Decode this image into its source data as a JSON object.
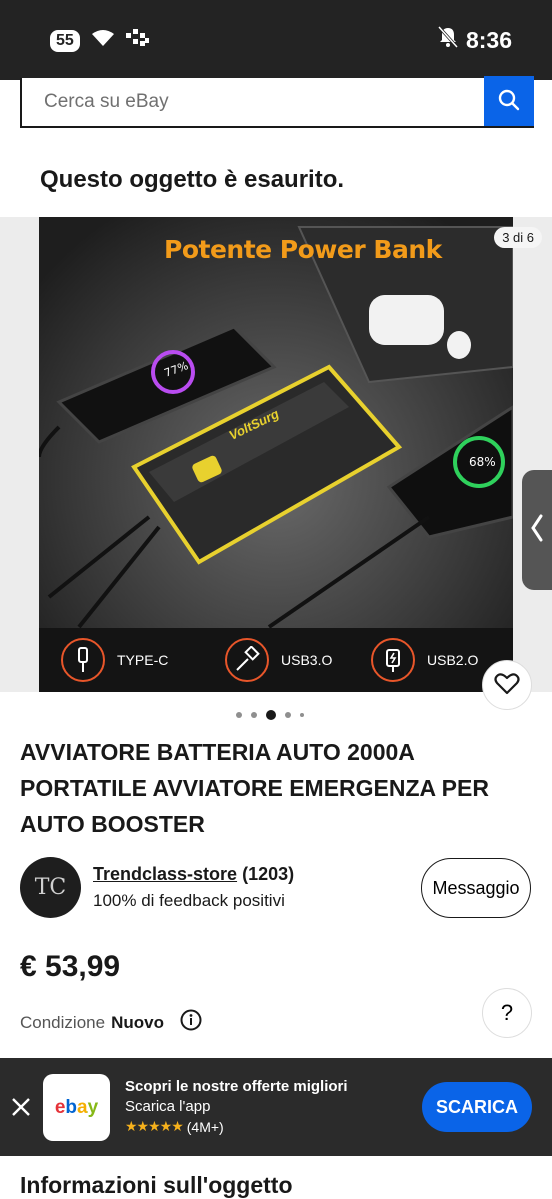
{
  "status_bar": {
    "battery": "55",
    "time": "8:36"
  },
  "search": {
    "placeholder": "Cerca su eBay"
  },
  "notice": {
    "out_of_stock": "Questo oggetto è esaurito."
  },
  "gallery": {
    "counter": "3 di 6",
    "image_title": "Potente Power Bank",
    "features": [
      "TYPE-C",
      "USB3.O",
      "USB2.O"
    ],
    "phone_left_percent": "77%",
    "phone_right_percent": "68%",
    "brand_mark": "VoltSurg",
    "current_index": 3,
    "total": 5
  },
  "product": {
    "title": "AVVIATORE BATTERIA AUTO 2000A PORTATILE AVVIATORE EMERGENZA PER AUTO BOOSTER",
    "price": "€ 53,99",
    "condition_label": "Condizione",
    "condition_value": "Nuovo"
  },
  "seller": {
    "name": "Trendclass-store",
    "count": "(1203)",
    "feedback": "100% di feedback positivi",
    "avatar_text": "TC",
    "message_label": "Messaggio"
  },
  "help": {
    "label": "?"
  },
  "app_banner": {
    "logo": "ebay",
    "title": "Scopri le nostre offerte migliori",
    "subtitle": "Scarica l'app",
    "stars": "★★★★★",
    "rating_count": "(4M+)",
    "cta": "SCARICA"
  },
  "section": {
    "heading": "Informazioni sull'oggetto"
  },
  "colors": {
    "accent": "#0a64e8",
    "image_title": "#f29b1a",
    "feature_ring": "#e8562a",
    "star": "#f6b11c"
  }
}
